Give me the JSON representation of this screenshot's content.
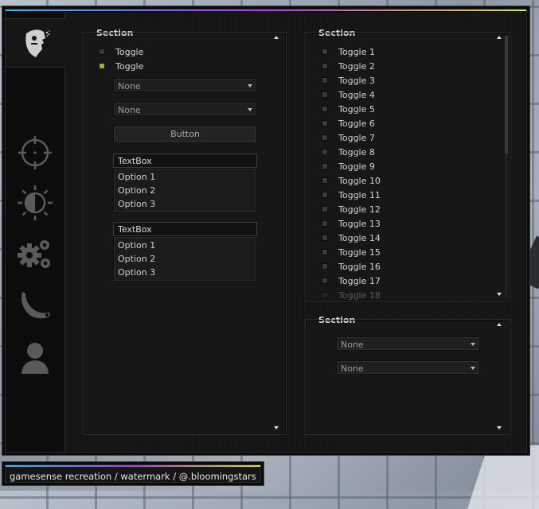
{
  "colors": {
    "accent_gradient": [
      "#3bb9e6",
      "#b33fd9",
      "#d7e63b"
    ],
    "checkbox_on": "#95b82c",
    "checkbox_off": "#3a3a3a",
    "icon_inactive": "#5a5a5a"
  },
  "sidebar": {
    "tabs": [
      {
        "icon": "ragebot-head-icon",
        "active": true
      },
      {
        "icon": "crosshair-icon",
        "active": false
      },
      {
        "icon": "visuals-contrast-icon",
        "active": false
      },
      {
        "icon": "gears-icon",
        "active": false
      },
      {
        "icon": "karambit-knife-icon",
        "active": false
      },
      {
        "icon": "player-icon",
        "active": false
      }
    ]
  },
  "left_section": {
    "title": "Section",
    "toggles": [
      {
        "label": "Toggle",
        "checked": false
      },
      {
        "label": "Toggle",
        "checked": true
      }
    ],
    "dropdowns": [
      {
        "value": "None"
      },
      {
        "value": "None"
      }
    ],
    "button_label": "Button",
    "listboxes": [
      {
        "textbox": "TextBox",
        "options": [
          "Option 1",
          "Option 2",
          "Option 3"
        ]
      },
      {
        "textbox": "TextBox",
        "options": [
          "Option 1",
          "Option 2",
          "Option 3"
        ]
      }
    ]
  },
  "right_top_section": {
    "title": "Section",
    "toggles": [
      "Toggle 1",
      "Toggle 2",
      "Toggle 3",
      "Toggle 4",
      "Toggle 5",
      "Toggle 6",
      "Toggle 7",
      "Toggle 8",
      "Toggle 9",
      "Toggle 10",
      "Toggle 11",
      "Toggle 12",
      "Toggle 13",
      "Toggle 14",
      "Toggle 15",
      "Toggle 16",
      "Toggle 17",
      "Toggle 18"
    ]
  },
  "right_bottom_section": {
    "title": "Section",
    "dropdowns": [
      {
        "value": "None"
      },
      {
        "value": "None"
      }
    ]
  },
  "watermark": {
    "text": "gamesense recreation / watermark / @.bloomingstars"
  }
}
